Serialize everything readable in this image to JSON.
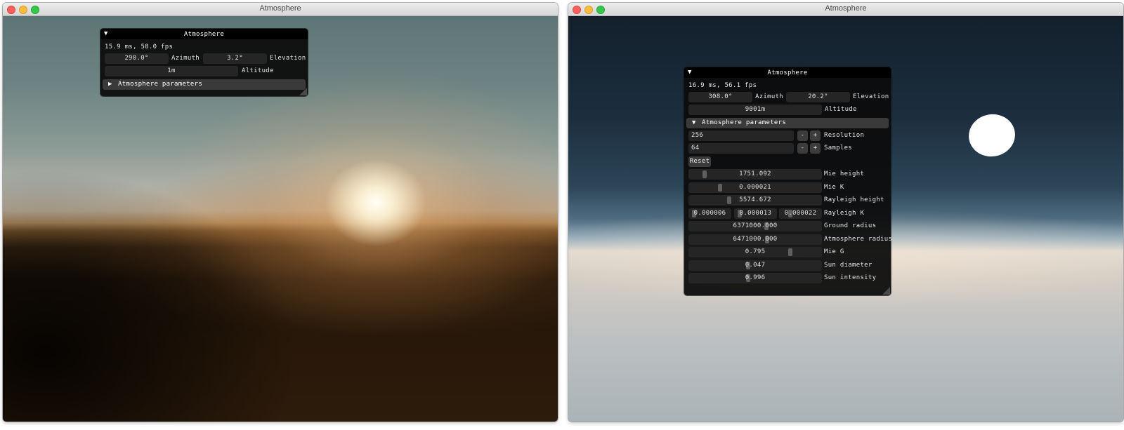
{
  "windows": [
    {
      "title": "Atmosphere",
      "panel": {
        "title": "Atmosphere",
        "fps": "15.9 ms, 58.0 fps",
        "azimuth": {
          "value": "290.0°",
          "label": "Azimuth"
        },
        "elevation": {
          "value": "3.2°",
          "label": "Elevation"
        },
        "altitude": {
          "value": "1m",
          "label": "Altitude"
        },
        "section": "Atmosphere parameters"
      }
    },
    {
      "title": "Atmosphere",
      "panel": {
        "title": "Atmosphere",
        "fps": "16.9 ms, 56.1 fps",
        "azimuth": {
          "value": "308.0°",
          "label": "Azimuth"
        },
        "elevation": {
          "value": "20.2°",
          "label": "Elevation"
        },
        "altitude": {
          "value": "9001m",
          "label": "Altitude"
        },
        "section": "Atmosphere parameters",
        "resolution": {
          "value": "256",
          "label": "Resolution"
        },
        "samples": {
          "value": "64",
          "label": "Samples"
        },
        "minus": "-",
        "plus": "+",
        "reset": "Reset",
        "sliders": {
          "mie_height": {
            "value": "1751.092",
            "label": "Mie height",
            "level": 0.1
          },
          "mie_k": {
            "value": "0.000021",
            "label": "Mie K",
            "level": 0.22
          },
          "rayleigh_height": {
            "value": "5574.672",
            "label": "Rayleigh height",
            "level": 0.29
          },
          "rayleigh_k": {
            "values": [
              "0.000006",
              "0.000013",
              "0.000022"
            ],
            "label": "Rayleigh K",
            "levels": [
              0.06,
              0.06,
              0.2
            ]
          },
          "ground_radius": {
            "value": "6371000.000",
            "label": "Ground radius",
            "level": 0.58
          },
          "atmosphere_radius": {
            "value": "6471000.000",
            "label": "Atmosphere radius",
            "level": 0.59
          },
          "mie_g": {
            "value": "0.795",
            "label": "Mie G",
            "level": 0.77
          },
          "sun_diameter": {
            "value": "0.047",
            "label": "Sun diameter",
            "level": 0.44
          },
          "sun_intensity": {
            "value": "0.996",
            "label": "Sun intensity",
            "level": 0.44
          }
        }
      }
    }
  ]
}
